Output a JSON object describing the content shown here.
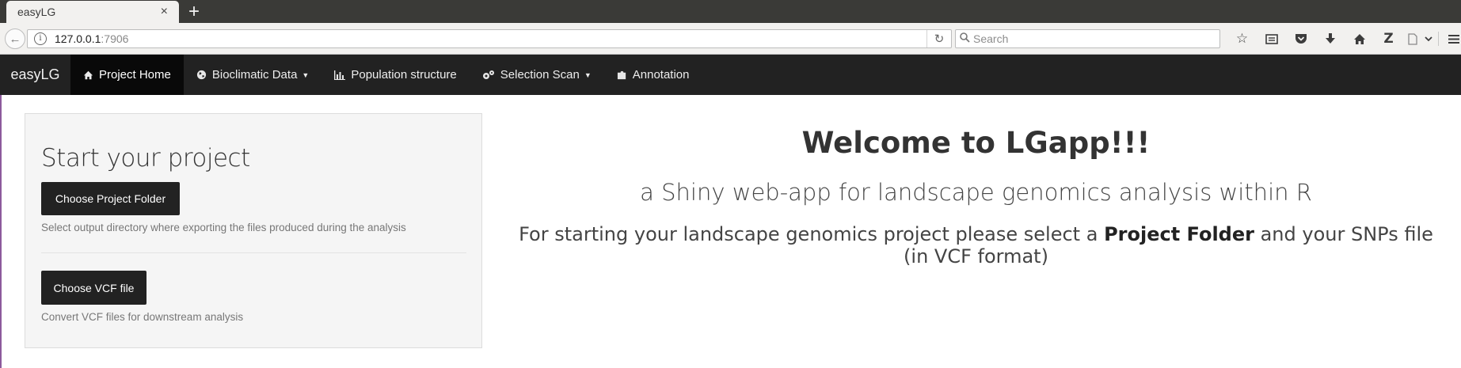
{
  "browser": {
    "tab_title": "easyLG",
    "tab_close": "×",
    "new_tab": "+",
    "url_host": "127.0.0.1",
    "url_port": ":7906",
    "search_placeholder": "Search"
  },
  "app_nav": {
    "brand": "easyLG",
    "items": [
      {
        "label": "Project Home",
        "icon": "home-icon",
        "active": true
      },
      {
        "label": "Bioclimatic Data",
        "icon": "globe-icon",
        "dropdown": true
      },
      {
        "label": "Population structure",
        "icon": "bar-chart-icon"
      },
      {
        "label": "Selection Scan",
        "icon": "cogs-icon",
        "dropdown": true
      },
      {
        "label": "Annotation",
        "icon": "puzzle-icon"
      }
    ]
  },
  "panel": {
    "title": "Start your project",
    "folder_button": "Choose Project Folder",
    "folder_help": "Select output directory where exporting the files produced during the analysis",
    "vcf_button": "Choose VCF file",
    "vcf_help": "Convert VCF files for downstream analysis"
  },
  "welcome": {
    "title": "Welcome to LGapp!!!",
    "subtitle": "a Shiny web-app for landscape genomics analysis within R",
    "text_before": "For starting your landscape genomics project please select a ",
    "text_bold": "Project Folder",
    "text_after": " and your SNPs file (in VCF format)"
  }
}
